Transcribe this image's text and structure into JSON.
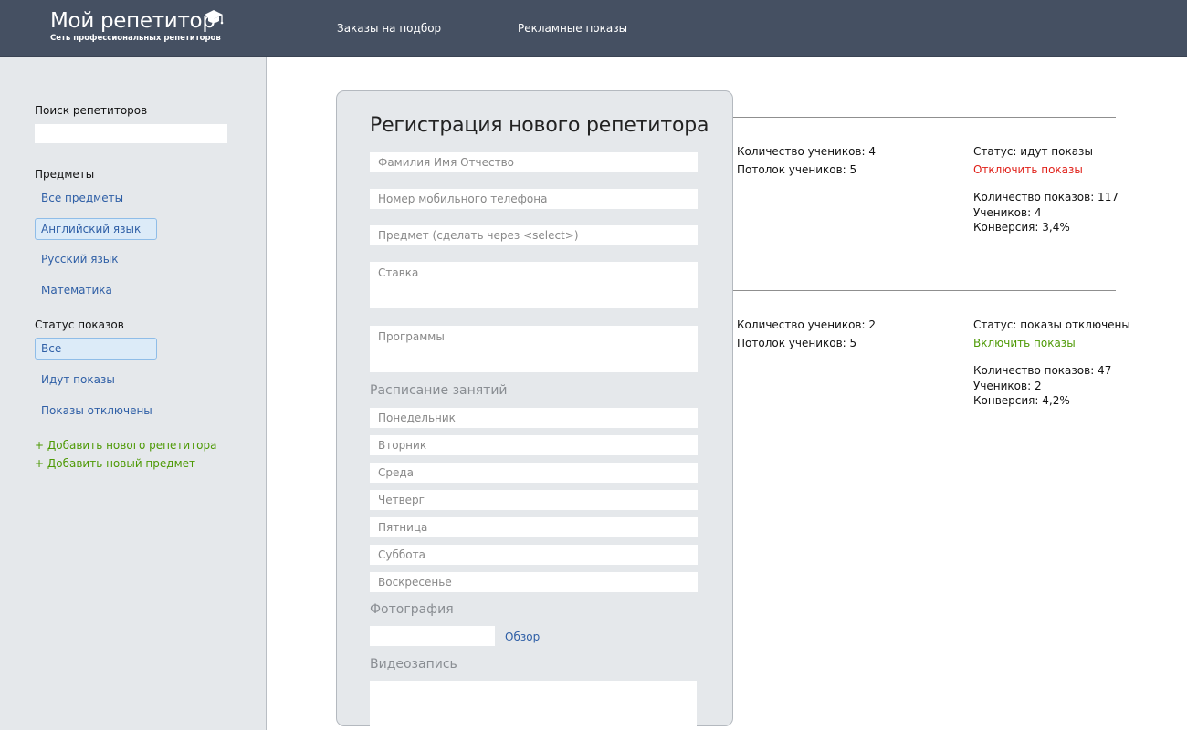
{
  "header": {
    "logo_title": "Мой репетитор",
    "logo_subtitle": "Сеть профессиональных репетиторов",
    "nav": [
      "Заказы на подбор",
      "Рекламные показы"
    ]
  },
  "sidebar": {
    "search_label": "Поиск репетиторов",
    "search_value": "",
    "subjects_label": "Предметы",
    "subjects": [
      {
        "label": "Все предметы",
        "active": false
      },
      {
        "label": "Английский язык",
        "active": true
      },
      {
        "label": "Русский язык",
        "active": false
      },
      {
        "label": "Математика",
        "active": false
      }
    ],
    "status_label": "Статус показов",
    "statuses": [
      {
        "label": "Все",
        "active": true
      },
      {
        "label": "Идут показы",
        "active": false
      },
      {
        "label": "Показы отключены",
        "active": false
      }
    ],
    "add_tutor": "+ Добавить нового репетитора",
    "add_subject": "+ Добавить новый предмет"
  },
  "form": {
    "title": "Регистрация нового репетитора",
    "fio_placeholder": "Фамилия Имя Отчество",
    "phone_placeholder": "Номер мобильного телефона",
    "subject_placeholder": "Предмет (сделать через <select>)",
    "rate_placeholder": "Ставка",
    "programs_placeholder": "Программы",
    "schedule_label": "Расписание занятий",
    "days": [
      "Понедельник",
      "Вторник",
      "Среда",
      "Четверг",
      "Пятница",
      "Суббота",
      "Воскресенье"
    ],
    "photo_label": "Фотография",
    "browse": "Обзор",
    "video_label": "Видеозапись"
  },
  "tutors": [
    {
      "students": "Количество учеников: 4",
      "cap": "Потолок учеников: 5",
      "status": "Статус: идут показы",
      "action": "Отключить показы",
      "action_color": "#e0211a",
      "shows": "Количество показов: 117",
      "pupils": "Учеников: 4",
      "conversion": "Конверсия: 3,4%"
    },
    {
      "students": "Количество учеников: 2",
      "cap": "Потолок учеников: 5",
      "status": "Статус: показы отключены",
      "action": "Включить показы",
      "action_color": "#4e9a06",
      "shows": "Количество показов: 47",
      "pupils": "Учеников: 2",
      "conversion": "Конверсия: 4,2%"
    }
  ],
  "colors": {
    "header_bg": "#455062",
    "sidebar_bg": "#e5e8eb",
    "link_blue": "#2f5fa6",
    "add_green": "#4e9a06",
    "active_bg": "#dcebf8"
  }
}
